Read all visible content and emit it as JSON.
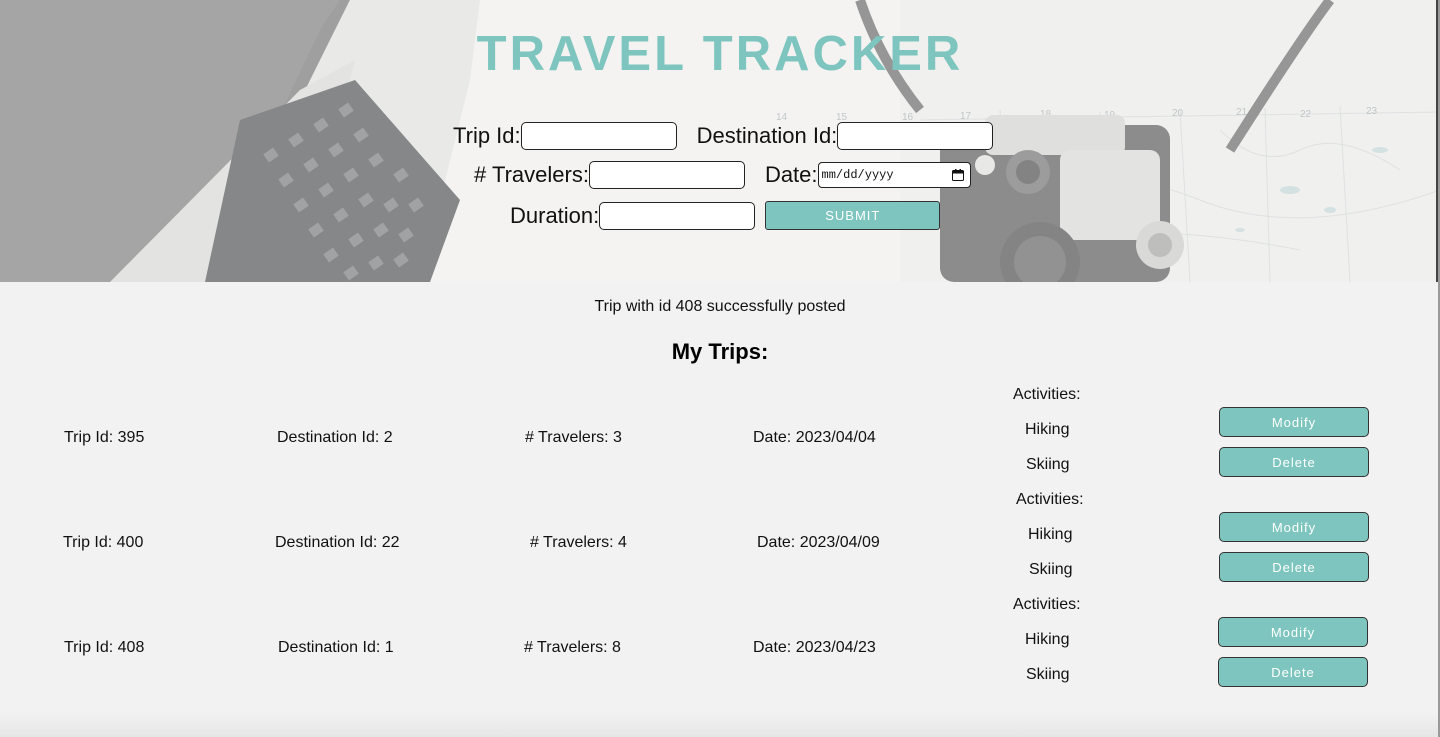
{
  "header": {
    "title": "TRAVEL TRACKER"
  },
  "form": {
    "trip_id_label": "Trip Id:",
    "trip_id_value": "",
    "destination_id_label": "Destination Id:",
    "destination_id_value": "",
    "travelers_label": "# Travelers:",
    "travelers_value": "",
    "date_label": "Date:",
    "date_placeholder": "mm/dd/yyyy",
    "duration_label": "Duration:",
    "duration_value": "",
    "submit_label": "SUBMIT"
  },
  "status_message": "Trip with id 408 successfully posted",
  "trips_section": {
    "title": "My Trips:",
    "modify_label": "Modify",
    "delete_label": "Delete",
    "trips": [
      {
        "trip_id": "Trip Id: 395",
        "destination_id": "Destination Id: 2",
        "travelers": "# Travelers: 3",
        "date": "Date: 2023/04/04",
        "activities_label": "Activities:",
        "activities": [
          "Hiking",
          "Skiing"
        ]
      },
      {
        "trip_id": "Trip Id: 400",
        "destination_id": "Destination Id: 22",
        "travelers": "# Travelers: 4",
        "date": "Date: 2023/04/09",
        "activities_label": "Activities:",
        "activities": [
          "Hiking",
          "Skiing"
        ]
      },
      {
        "trip_id": "Trip Id: 408",
        "destination_id": "Destination Id: 1",
        "travelers": "# Travelers: 8",
        "date": "Date: 2023/04/23",
        "activities_label": "Activities:",
        "activities": [
          "Hiking",
          "Skiing"
        ]
      }
    ]
  },
  "colors": {
    "accent": "#7dc5be",
    "page_background": "#f2f2f2"
  },
  "icons": {
    "date_picker": "calendar-icon",
    "hero_image": "laptop-camera-map-photo"
  }
}
